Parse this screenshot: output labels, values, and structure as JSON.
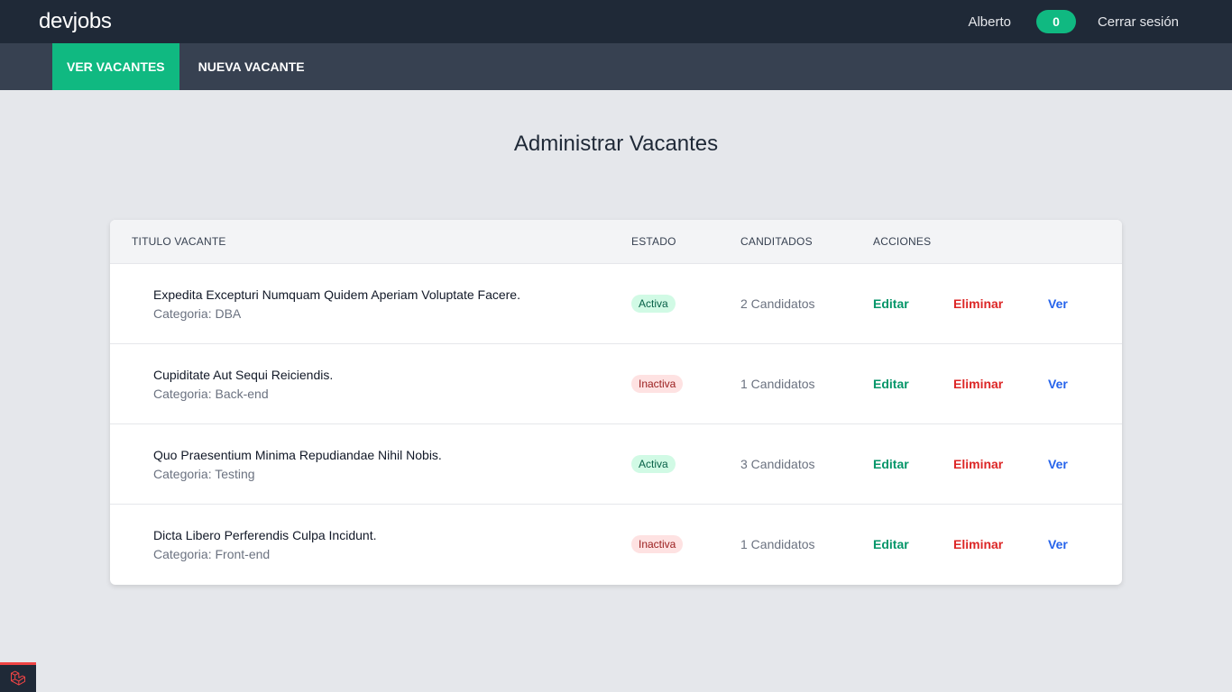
{
  "header": {
    "brand": "devjobs",
    "user_name": "Alberto",
    "notifications": "0",
    "logout": "Cerrar sesión"
  },
  "subnav": {
    "items": [
      {
        "label": "Ver Vacantes",
        "active": true
      },
      {
        "label": "Nueva Vacante",
        "active": false
      }
    ]
  },
  "page": {
    "title": "Administrar Vacantes"
  },
  "table": {
    "headers": {
      "titulo": "Titulo Vacante",
      "estado": "Estado",
      "candidatos": "Canditados",
      "acciones": "Acciones"
    },
    "rows": [
      {
        "title": "Expedita Excepturi Numquam Quidem Aperiam Voluptate Facere.",
        "category": "Categoria: DBA",
        "status": "Activa",
        "candidates": "2 Candidatos",
        "edit": "Editar",
        "delete": "Eliminar",
        "view": "Ver"
      },
      {
        "title": "Cupiditate Aut Sequi Reiciendis.",
        "category": "Categoria: Back-end",
        "status": "Inactiva",
        "candidates": "1 Candidatos",
        "edit": "Editar",
        "delete": "Eliminar",
        "view": "Ver"
      },
      {
        "title": "Quo Praesentium Minima Repudiandae Nihil Nobis.",
        "category": "Categoria: Testing",
        "status": "Activa",
        "candidates": "3 Candidatos",
        "edit": "Editar",
        "delete": "Eliminar",
        "view": "Ver"
      },
      {
        "title": "Dicta Libero Perferendis Culpa Incidunt.",
        "category": "Categoria: Front-end",
        "status": "Inactiva",
        "candidates": "1 Candidatos",
        "edit": "Editar",
        "delete": "Eliminar",
        "view": "Ver"
      }
    ]
  },
  "colors": {
    "topbar": "#1f2937",
    "subnav": "#374151",
    "accent": "#10b981",
    "danger": "#dc2626",
    "link": "#2563eb"
  },
  "icons": {
    "debug_tab": "laravel-icon"
  }
}
